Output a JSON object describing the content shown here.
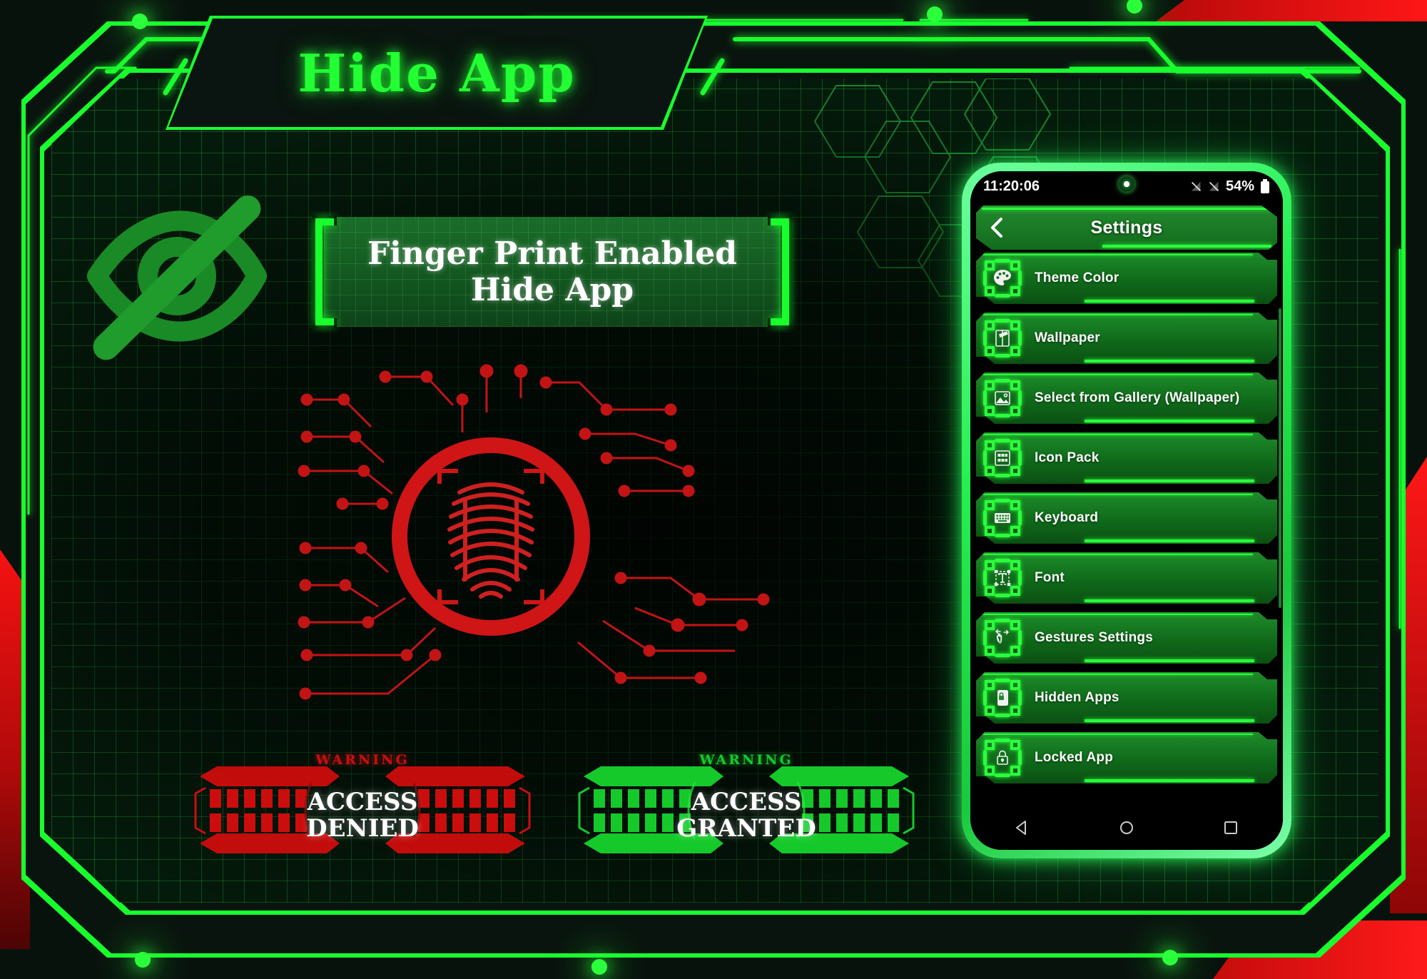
{
  "app": {
    "title": "Hide App",
    "accent_green": "#19ff2e",
    "accent_red": "#ff1414",
    "panel_green": "#1e8c2a"
  },
  "hero": {
    "eye_icon": "eye-off-icon",
    "banner_line1": "Finger Print Enabled",
    "banner_line2": "Hide App",
    "fingerprint_icon": "fingerprint-scanner-icon"
  },
  "badges": [
    {
      "id": "access-denied",
      "warning": "WARNING",
      "line1": "ACCESS",
      "line2": "DENIED",
      "color": "#cc0d0d"
    },
    {
      "id": "access-granted",
      "warning": "WARNING",
      "line1": "ACCESS",
      "line2": "GRANTED",
      "color": "#15c92a"
    }
  ],
  "phone": {
    "statusbar": {
      "time": "11:20:06",
      "battery_percent": "54%",
      "signal_icon_1": "signal-off-icon",
      "signal_icon_2": "signal-off-icon",
      "battery_icon": "battery-icon",
      "camera_icon": "front-camera-icon"
    },
    "header": {
      "back_icon": "chevron-left-icon",
      "title": "Settings"
    },
    "settings_items": [
      {
        "icon": "palette-icon",
        "label": "Theme Color"
      },
      {
        "icon": "wallpaper-icon",
        "label": "Wallpaper"
      },
      {
        "icon": "image-icon",
        "label": "Select from Gallery (Wallpaper)"
      },
      {
        "icon": "grid-icon",
        "label": "Icon Pack"
      },
      {
        "icon": "keyboard-icon",
        "label": "Keyboard"
      },
      {
        "icon": "font-icon",
        "label": "Font"
      },
      {
        "icon": "gesture-icon",
        "label": "Gestures Settings"
      },
      {
        "icon": "phone-lock-icon",
        "label": "Hidden Apps"
      },
      {
        "icon": "lock-icon",
        "label": "Locked App"
      }
    ],
    "navbar": [
      {
        "icon": "back-triangle-icon",
        "name": "back"
      },
      {
        "icon": "home-circle-icon",
        "name": "home"
      },
      {
        "icon": "recents-square-icon",
        "name": "recents"
      }
    ]
  }
}
